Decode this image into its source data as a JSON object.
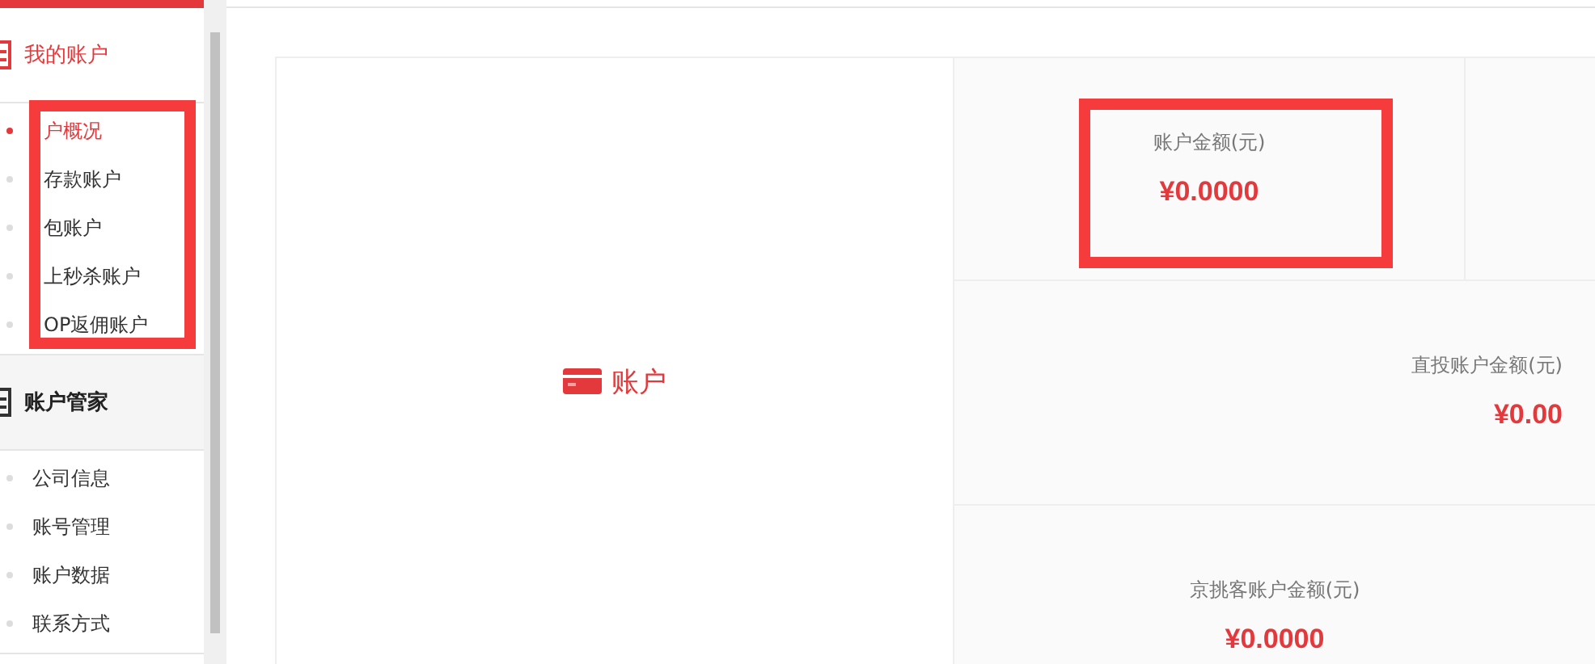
{
  "sidebar": {
    "sections": [
      {
        "title": "我的账户",
        "active": true,
        "items": [
          {
            "label": "户概况",
            "selected": true
          },
          {
            "label": "存款账户",
            "selected": false
          },
          {
            "label": "包账户",
            "selected": false
          },
          {
            "label": "上秒杀账户",
            "selected": false
          },
          {
            "label": "OP返佣账户",
            "selected": false
          }
        ]
      },
      {
        "title": "账户管家",
        "active": false,
        "items": [
          {
            "label": "公司信息",
            "selected": false
          },
          {
            "label": "账号管理",
            "selected": false
          },
          {
            "label": "账户数据",
            "selected": false
          },
          {
            "label": "联系方式",
            "selected": false
          }
        ]
      }
    ]
  },
  "account": {
    "title": "账户",
    "stats": [
      {
        "label": "账户金额(元)",
        "value": "¥0.0000"
      },
      {
        "label": "直投账户金额(元)",
        "value": "¥0.00"
      },
      {
        "label": "京挑客账户金额(元)",
        "value": "¥0.0000"
      }
    ]
  }
}
